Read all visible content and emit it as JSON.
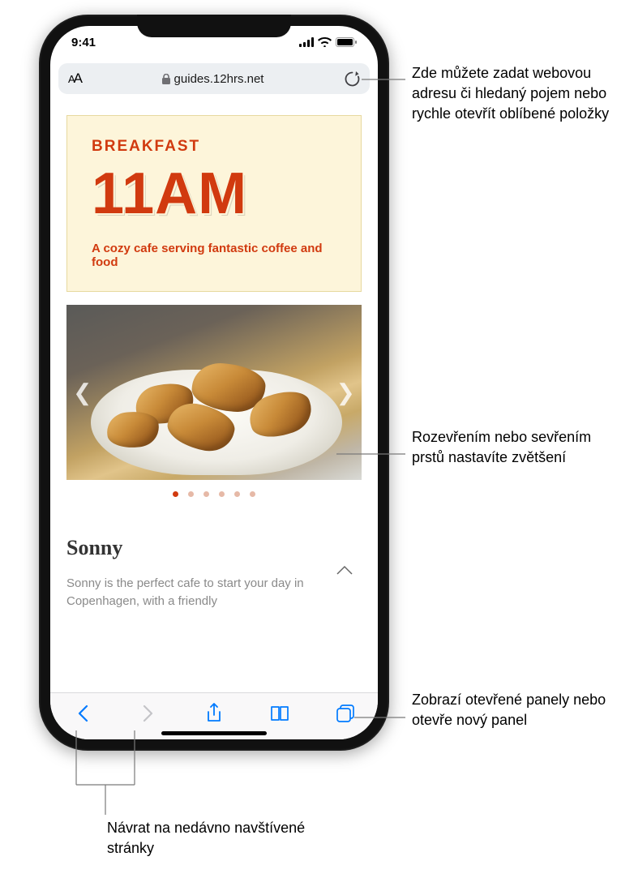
{
  "status": {
    "time": "9:41"
  },
  "addressbar": {
    "url": "guides.12hrs.net"
  },
  "banner": {
    "kicker": "BREAKFAST",
    "big": "11AM",
    "sub": "A cozy cafe serving fantastic coffee and food"
  },
  "gallery": {
    "dot_count": 6,
    "active": 0
  },
  "article": {
    "title": "Sonny",
    "body": "Sonny is the perfect cafe to start your day in Copenhagen, with a friendly"
  },
  "callouts": {
    "address": "Zde můžete zadat webovou adresu či hledaný pojem nebo rychle otevřít oblíbené položky",
    "zoom": "Rozevřením nebo sevřením prstů nastavíte zvětšení",
    "tabs": "Zobrazí otevřené panely nebo otevře nový panel",
    "back": "Návrat na nedávno navštívené stránky"
  }
}
